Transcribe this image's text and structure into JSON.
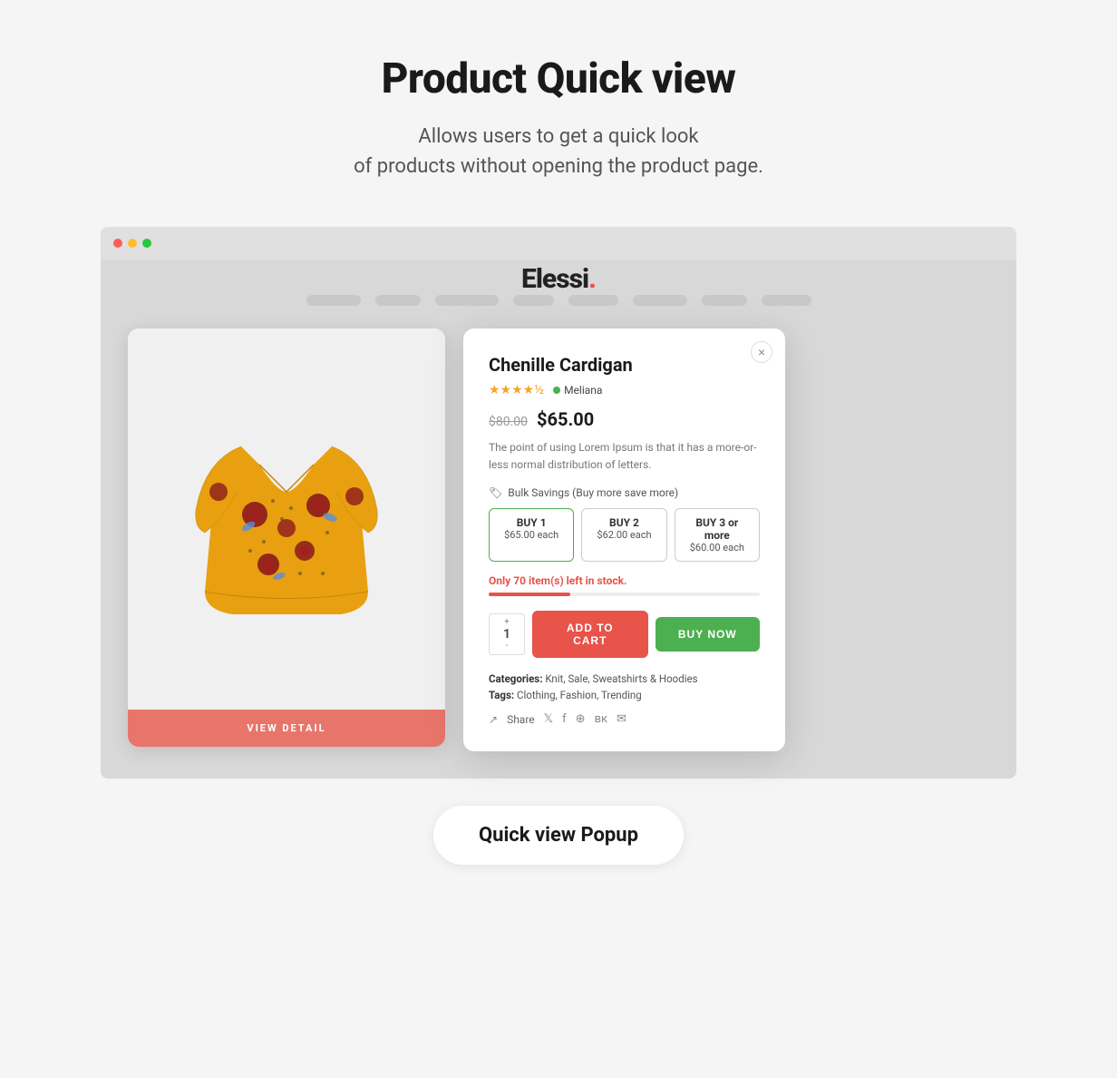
{
  "page": {
    "title": "Product Quick view",
    "subtitle_line1": "Allows users to get a quick look",
    "subtitle_line2": "of products without opening the product page."
  },
  "store": {
    "logo_text": "Elessi",
    "logo_dot": "."
  },
  "popup": {
    "product_name": "Chenille Cardigan",
    "brand": "Meliana",
    "rating_stars": "★★★★½",
    "price_original": "$80.00",
    "price_sale": "$65.00",
    "description": "The point of using Lorem Ipsum is that it has a more-or-less normal distribution of letters.",
    "bulk_savings_label": "Bulk Savings (Buy more save more)",
    "bulk_options": [
      {
        "label": "BUY 1",
        "price": "$65.00 each"
      },
      {
        "label": "BUY 2",
        "price": "$62.00 each"
      },
      {
        "label": "BUY 3 or more",
        "price": "$60.00 each"
      }
    ],
    "stock_text_prefix": "Only ",
    "stock_number": "70",
    "stock_text_suffix": " item(s) left in stock.",
    "quantity": "1",
    "quantity_plus": "+",
    "quantity_minus": "-",
    "add_to_cart_label": "ADD TO CART",
    "buy_now_label": "BUY NOW",
    "categories_label": "Categories:",
    "categories_value": "Knit, Sale, Sweatshirts & Hoodies",
    "tags_label": "Tags:",
    "tags_value": "Clothing, Fashion, Trending",
    "share_label": "Share",
    "close_icon": "×"
  },
  "view_detail_label": "VIEW DETAIL",
  "popup_pill_label": "Quick view Popup",
  "nav_widths": [
    60,
    50,
    70,
    45,
    55,
    60,
    50,
    55
  ]
}
